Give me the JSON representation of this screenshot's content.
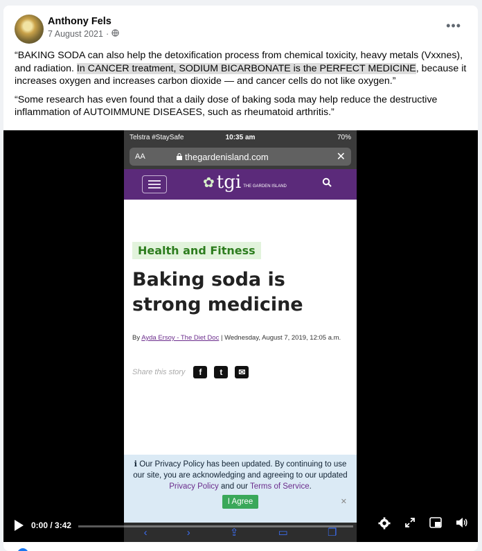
{
  "post": {
    "author": "Anthony Fels",
    "date": "7 August 2021",
    "dot": "·",
    "more": "•••",
    "para1_a": "“BAKING SODA can also help the detoxification process from chemical toxicity, heavy metals (Vxxnes), and radiation. ",
    "para1_b": "In CANCER treatment, SODIUM BICARBONATE is the PERFECT MEDICINE",
    "para1_c": ", because it increases oxygen and increases carbon dioxide — and cancer cells do not like oxygen.”",
    "para2": "“Some research has even found that a daily dose of baking soda may help reduce the destructive inflammation of AUTOIMMUNE DISEASES, such as rheumatoid arthritis.”"
  },
  "phone": {
    "carrier": "Telstra #StaySafe",
    "time": "10:35 am",
    "battery": "70%",
    "aa": "AA",
    "url": "thegardenisland.com",
    "close": "✕",
    "logo_text": "tgi",
    "logo_sub": "THE GARDEN ISLAND",
    "section": "Health and Fitness",
    "headline": "Baking soda is strong medicine",
    "byline_by": "By ",
    "byline_author": "Ayda Ersoy - The Diet Doc",
    "byline_rest": " | Wednesday, August 7, 2019, 12:05 a.m.",
    "share_label": "Share this story",
    "share_fb": "f",
    "share_tw": "t",
    "share_mail": "✉",
    "privacy_1": "Our Privacy Policy has been updated. By continuing to use our site, you are acknowledging and agreeing to our updated ",
    "privacy_link1": "Privacy Policy",
    "privacy_2": " and our ",
    "privacy_link2": "Terms of Service",
    "privacy_3": ".",
    "agree": "I Agree",
    "privacy_close": "✕"
  },
  "video": {
    "current": "0:00",
    "duration": "3:42",
    "time_text": "0:00 / 3:42",
    "progress_fraction": 0
  },
  "icons": {
    "settings": "gear-icon",
    "fullscreen": "expand-icon",
    "pip": "picture-in-picture-icon",
    "volume": "volume-icon"
  }
}
